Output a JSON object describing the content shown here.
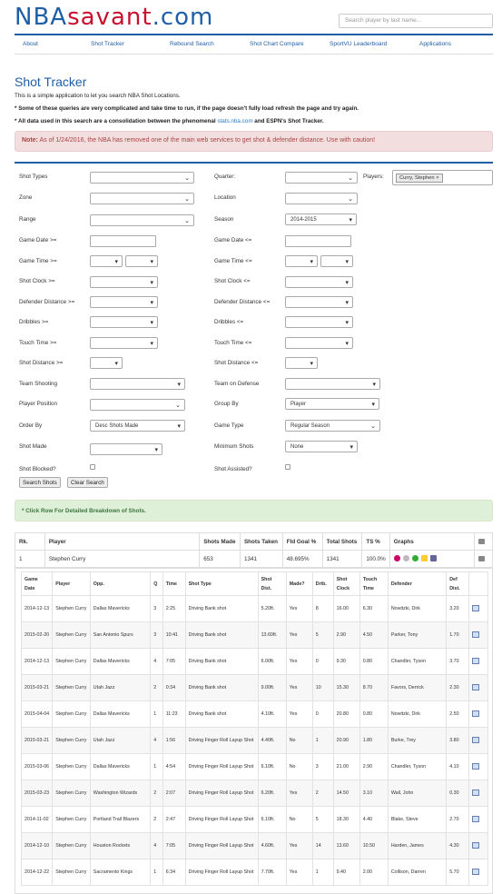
{
  "brand": {
    "part1": "NBA",
    "part2": "savant",
    "part3": ".com"
  },
  "search": {
    "placeholder": "Search player by last name..."
  },
  "nav": [
    "About",
    "Shot Tracker",
    "Rebound Search",
    "Shot Chart Compare",
    "SportVU Leaderboard",
    "Applications"
  ],
  "page": {
    "title": "Shot Tracker",
    "intro1": "This is a simple application to let you search NBA Shot Locations.",
    "intro2": "* Some of these queries are very complicated and take time to run, if the page doesn't fully load refresh the page and try again.",
    "intro3_pre": "* All data used in this search are a consolidation between the phenomenal ",
    "intro3_link": "stats.nba.com",
    "intro3_post": " and ESPN's Shot Tracker.",
    "alert_bold": "Note:",
    "alert_text": " As of 1/24/2016, the NBA has removed one of the main web services to get shot & defender distance. Use with caution!"
  },
  "form": {
    "shot_types": "Shot Types",
    "quarter": "Quarter:",
    "players": "Players:",
    "player_tag": "Curry, Stephen",
    "zone": "Zone",
    "location": "Location",
    "range": "Range",
    "season": "Season",
    "season_value": "2014-2015",
    "game_date_ge": "Game Date >=",
    "game_date_le": "Game Date <=",
    "game_time_ge": "Game Time >=",
    "game_time_le": "Game Time <=",
    "shot_clock_ge": "Shot Clock >=",
    "shot_clock_le": "Shot Clock <=",
    "def_dist_ge": "Defender Distance >=",
    "def_dist_le": "Defender Distance <=",
    "dribbles_ge": "Dribbles >=",
    "dribbles_le": "Dribbles <=",
    "touch_ge": "Touch Time >=",
    "touch_le": "Touch Time <=",
    "shot_dist_ge": "Shot Distance >=",
    "shot_dist_le": "Shot Distance <=",
    "team_shooting": "Team Shooting",
    "team_defense": "Team on Defense",
    "player_position": "Player Position",
    "group_by": "Group By",
    "group_by_value": "Player",
    "order_by": "Order By",
    "order_by_value": "Desc Shots Made",
    "game_type": "Game Type",
    "game_type_value": "Regular Season",
    "shot_made": "Shot Made",
    "min_shots": "Minimum Shots",
    "min_shots_value": "None",
    "shot_blocked": "Shot Blocked?",
    "shot_assisted": "Shot Assisted?",
    "search_btn": "Search Shots",
    "clear_btn": "Clear Search"
  },
  "green_note": "* Click Row For Detailed Breakdown of Shots.",
  "summary": {
    "headers": [
      "Rk.",
      "Player",
      "Shots Made",
      "Shots Taken",
      "Fld Goal %",
      "Total Shots",
      "TS %",
      "Graphs"
    ],
    "row": [
      "1",
      "Stephen Curry",
      "653",
      "1341",
      "48.695%",
      "1341",
      "100.0%"
    ]
  },
  "detail": {
    "headers": [
      "Game Date",
      "Player",
      "Opp.",
      "Q",
      "Time",
      "Shot Type",
      "Shot Dist.",
      "Made?",
      "Drib.",
      "Shot Clock",
      "Touch Time",
      "Defender",
      "Def Dist."
    ],
    "rows": [
      [
        "2014-12-13",
        "Stephen Curry",
        "Dallas Mavericks",
        "3",
        "2:25",
        "Driving Bank shot",
        "5.20ft.",
        "Yes",
        "8",
        "16.00",
        "6.30",
        "Nowitzki, Dirk",
        "3.20"
      ],
      [
        "2015-02-20",
        "Stephen Curry",
        "San Antonio Spurs",
        "3",
        "10:41",
        "Driving Bank shot",
        "13.60ft.",
        "Yes",
        "5",
        "2.90",
        "4.50",
        "Parker, Tony",
        "1.70"
      ],
      [
        "2014-12-13",
        "Stephen Curry",
        "Dallas Mavericks",
        "4",
        "7:05",
        "Driving Bank shot",
        "6.00ft.",
        "Yes",
        "0",
        "9.30",
        "0.80",
        "Chandler, Tyson",
        "3.70"
      ],
      [
        "2015-03-21",
        "Stephen Curry",
        "Utah Jazz",
        "2",
        "0:34",
        "Driving Bank shot",
        "9.00ft.",
        "Yes",
        "10",
        "15.30",
        "8.70",
        "Favors, Derrick",
        "2.30"
      ],
      [
        "2015-04-04",
        "Stephen Curry",
        "Dallas Mavericks",
        "1",
        "11:23",
        "Driving Bank shot",
        "4.10ft.",
        "Yes",
        "0",
        "20.80",
        "0.80",
        "Nowitzki, Dirk",
        "2.50"
      ],
      [
        "2015-03-21",
        "Stephen Curry",
        "Utah Jazz",
        "4",
        "1:56",
        "Driving Finger Roll Layup Shot",
        "4.40ft.",
        "No",
        "1",
        "20.90",
        "1.80",
        "Burke, Trey",
        "3.80"
      ],
      [
        "2015-03-06",
        "Stephen Curry",
        "Dallas Mavericks",
        "1",
        "4:54",
        "Driving Finger Roll Layup Shot",
        "6.10ft.",
        "No",
        "3",
        "21.00",
        "2.90",
        "Chandler, Tyson",
        "4.10"
      ],
      [
        "2015-03-23",
        "Stephen Curry",
        "Washington Wizards",
        "2",
        "2:07",
        "Driving Finger Roll Layup Shot",
        "6.20ft.",
        "Yes",
        "2",
        "14.50",
        "3.10",
        "Wall, John",
        "0.30"
      ],
      [
        "2014-11-02",
        "Stephen Curry",
        "Portland Trail Blazers",
        "2",
        "2:47",
        "Driving Finger Roll Layup Shot",
        "6.10ft.",
        "No",
        "5",
        "18.30",
        "4.40",
        "Blake, Steve",
        "2.70"
      ],
      [
        "2014-12-10",
        "Stephen Curry",
        "Houston Rockets",
        "4",
        "7:05",
        "Driving Finger Roll Layup Shot",
        "4.60ft.",
        "Yes",
        "14",
        "13.60",
        "10.50",
        "Harden, James",
        "4.30"
      ],
      [
        "2014-12-22",
        "Stephen Curry",
        "Sacramento Kings",
        "1",
        "6:34",
        "Driving Finger Roll Layup Shot",
        "7.70ft.",
        "Yes",
        "1",
        "9.40",
        "2.00",
        "Collison, Darren",
        "5.70"
      ]
    ]
  }
}
